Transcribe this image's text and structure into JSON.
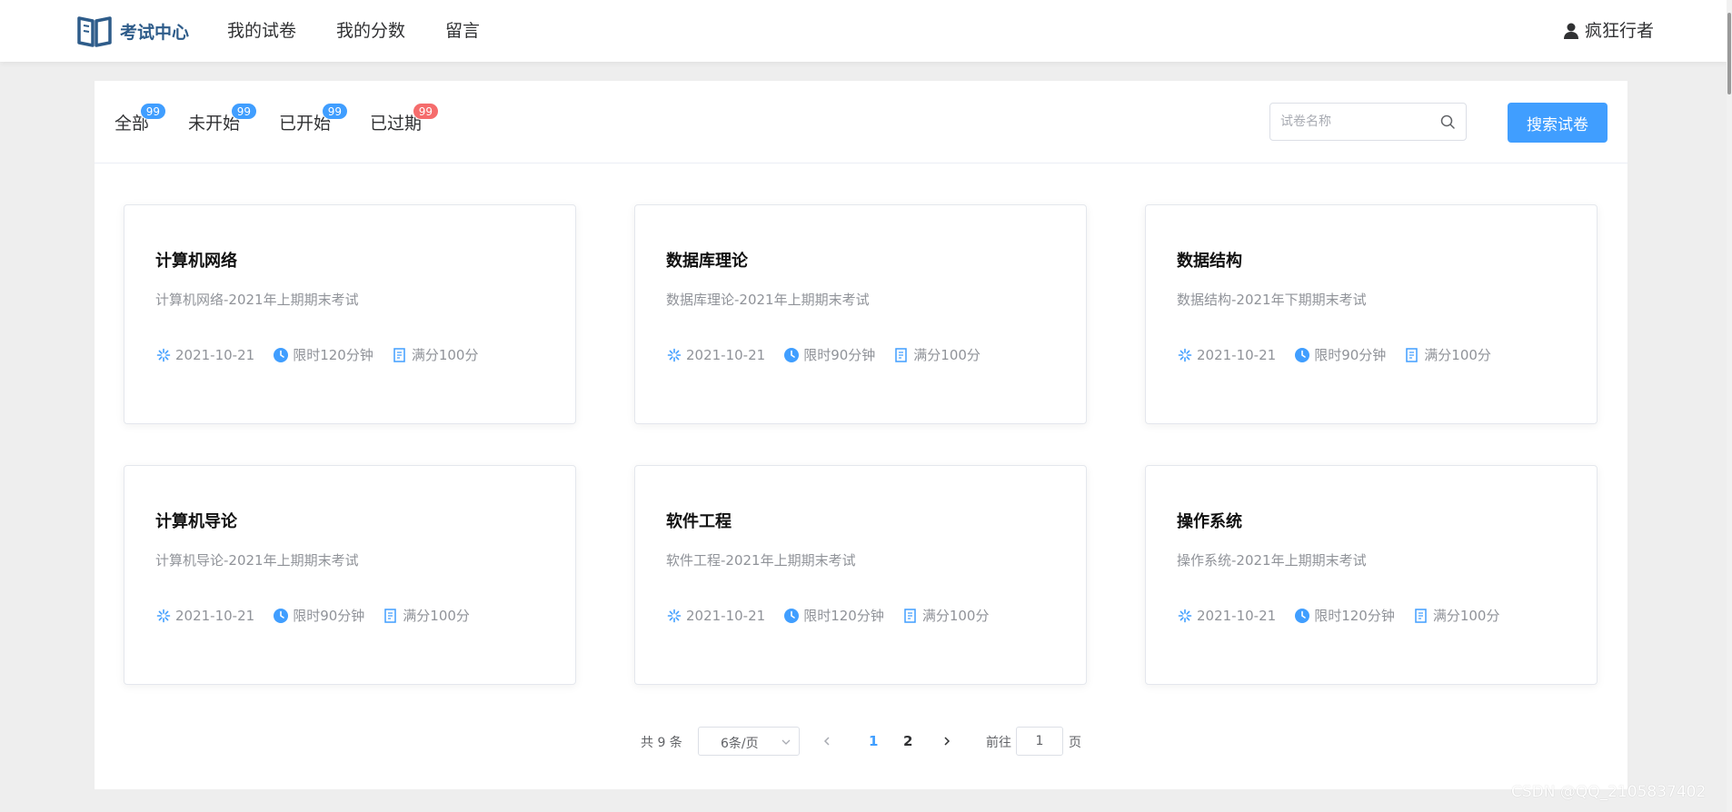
{
  "header": {
    "logo_icon": "open-book-icon",
    "logo_text": "考试中心",
    "nav": [
      {
        "label": "我的试卷"
      },
      {
        "label": "我的分数"
      },
      {
        "label": "留言"
      }
    ],
    "user_icon": "user-icon",
    "user_name": "疯狂行者"
  },
  "colors": {
    "primary": "#409eff",
    "badge_danger": "#f56c6c",
    "logo": "#2e5c8a"
  },
  "filter_tabs": [
    {
      "label": "全部",
      "count": "99",
      "badge_color": "blue"
    },
    {
      "label": "未开始",
      "count": "99",
      "badge_color": "blue"
    },
    {
      "label": "已开始",
      "count": "99",
      "badge_color": "blue"
    },
    {
      "label": "已过期",
      "count": "99",
      "badge_color": "red"
    }
  ],
  "search": {
    "placeholder": "试卷名称",
    "value": "",
    "button_label": "搜索试卷"
  },
  "exams": [
    {
      "title": "计算机网络",
      "subtitle": "计算机网络-2021年上期期末考试",
      "date": "2021-10-21",
      "duration": "限时120分钟",
      "score": "满分100分"
    },
    {
      "title": "数据库理论",
      "subtitle": "数据库理论-2021年上期期末考试",
      "date": "2021-10-21",
      "duration": "限时90分钟",
      "score": "满分100分"
    },
    {
      "title": "数据结构",
      "subtitle": "数据结构-2021年下期期末考试",
      "date": "2021-10-21",
      "duration": "限时90分钟",
      "score": "满分100分"
    },
    {
      "title": "计算机导论",
      "subtitle": "计算机导论-2021年上期期末考试",
      "date": "2021-10-21",
      "duration": "限时90分钟",
      "score": "满分100分"
    },
    {
      "title": "软件工程",
      "subtitle": "软件工程-2021年上期期末考试",
      "date": "2021-10-21",
      "duration": "限时120分钟",
      "score": "满分100分"
    },
    {
      "title": "操作系统",
      "subtitle": "操作系统-2021年上期期末考试",
      "date": "2021-10-21",
      "duration": "限时120分钟",
      "score": "满分100分"
    }
  ],
  "pagination": {
    "total_text": "共 9 条",
    "page_size": "6条/页",
    "pages": [
      "1",
      "2"
    ],
    "current_page": "1",
    "goto_label": "前往",
    "goto_value": "1",
    "goto_unit": "页"
  },
  "watermark": "CSDN @QQ_2105837402"
}
